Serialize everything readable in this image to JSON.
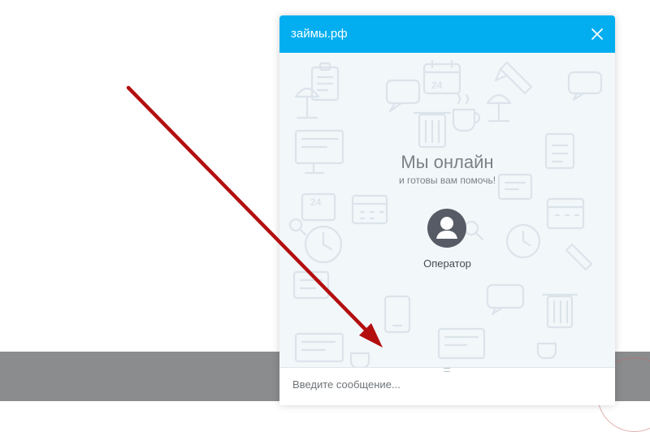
{
  "widget": {
    "title": "займы.рф",
    "close_icon": "close-icon",
    "status_title": "Мы онлайн",
    "status_subtitle": "и готовы вам помочь!",
    "operator_label": "Оператор",
    "avatar_icon": "user-silhouette-icon",
    "message_placeholder": "Введите сообщение..."
  },
  "colors": {
    "header": "#02aef0",
    "annotation_arrow": "#b30f0f",
    "page_band": "#8b8c8e"
  }
}
